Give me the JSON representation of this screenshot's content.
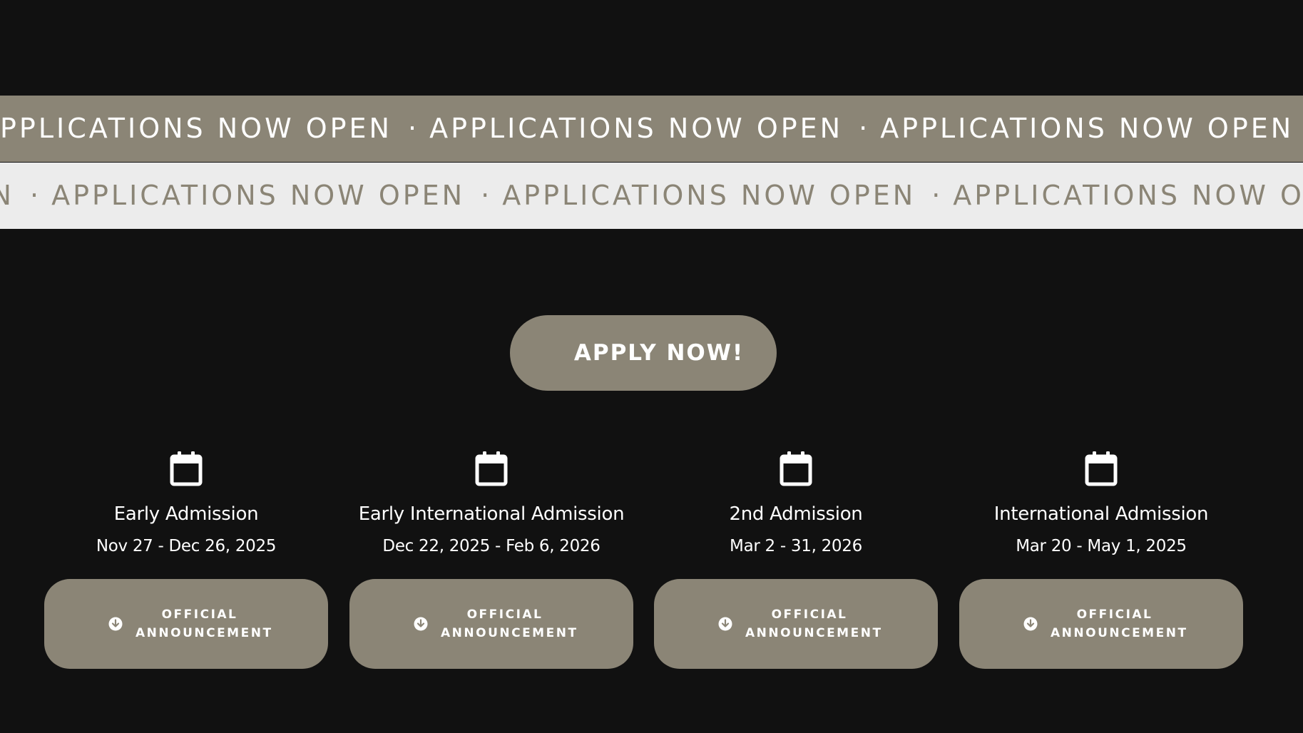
{
  "marquee": {
    "top": {
      "text": "APPLICATIONS NOW OPEN",
      "separator": "·",
      "bg_color": "#8b8576",
      "text_color": "#ffffff"
    },
    "bottom": {
      "text": "APPLICATIONS NOW OPEN",
      "separator": "·",
      "bg_color": "#ececec",
      "text_color": "#8b8576"
    }
  },
  "apply_button": {
    "label": "APPLY NOW!"
  },
  "admissions": [
    {
      "icon": "calendar-icon",
      "title": "Early Admission",
      "dates": "Nov 27 - Dec 26, 2025",
      "button_icon": "download-circle-icon",
      "button_label_line1": "OFFICIAL",
      "button_label_line2": "ANNOUNCEMENT"
    },
    {
      "icon": "calendar-icon",
      "title": "Early International Admission",
      "dates": "Dec 22, 2025 - Feb 6, 2026",
      "button_icon": "download-circle-icon",
      "button_label_line1": "OFFICIAL",
      "button_label_line2": "ANNOUNCEMENT"
    },
    {
      "icon": "calendar-icon",
      "title": "2nd Admission",
      "dates": "Mar 2 - 31, 2026",
      "button_icon": "download-circle-icon",
      "button_label_line1": "OFFICIAL",
      "button_label_line2": "ANNOUNCEMENT"
    },
    {
      "icon": "calendar-icon",
      "title": "International Admission",
      "dates": "Mar 20 - May 1, 2025",
      "button_icon": "download-circle-icon",
      "button_label_line1": "OFFICIAL",
      "button_label_line2": "ANNOUNCEMENT"
    }
  ],
  "colors": {
    "background": "#111111",
    "accent": "#8b8576",
    "light_band": "#ececec",
    "text": "#ffffff"
  }
}
